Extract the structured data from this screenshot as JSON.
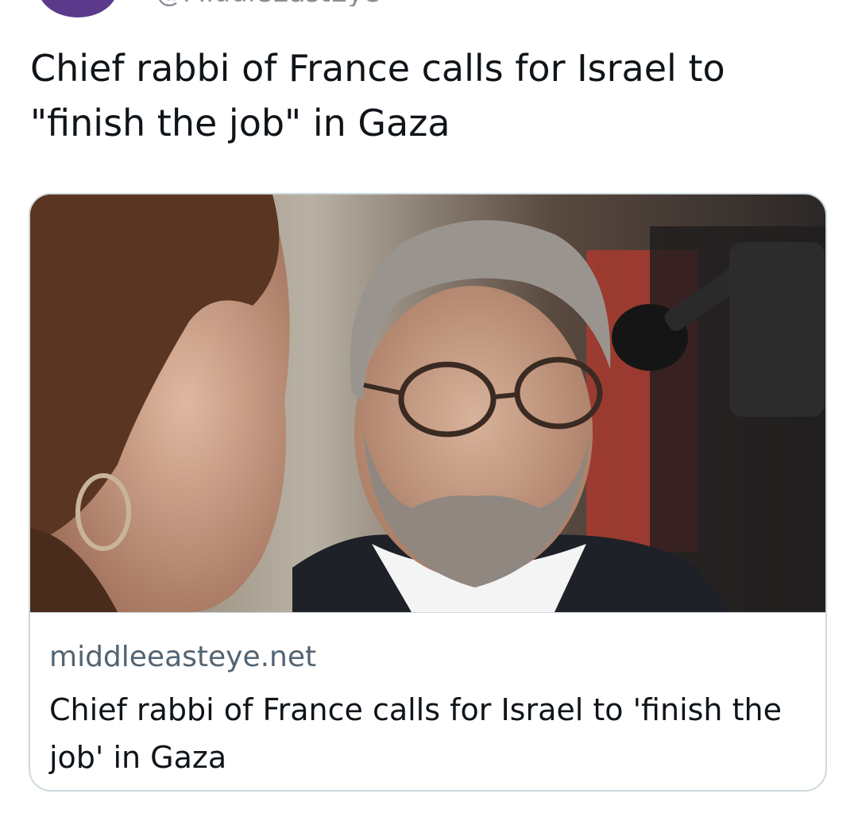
{
  "tweet": {
    "author_handle": "@MiddleEastEye",
    "text": "Chief rabbi of France calls for Israel to \"finish the job\" in Gaza"
  },
  "link_card": {
    "domain": "middleeasteye.net",
    "title": "Chief rabbi of France calls for Israel to 'finish the job' in Gaza"
  },
  "colors": {
    "avatar": "#5b3a8c",
    "text_primary": "#0f1419",
    "text_secondary": "#536471",
    "card_border": "#cfd9de"
  }
}
